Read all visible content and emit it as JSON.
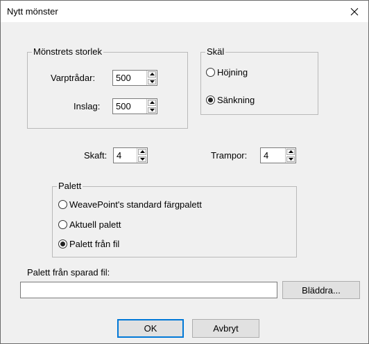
{
  "window": {
    "title": "Nytt mönster"
  },
  "size_group": {
    "label": "Mönstrets storlek",
    "warp_label": "Varptrådar:",
    "warp_value": "500",
    "weft_label": "Inslag:",
    "weft_value": "500"
  },
  "reason_group": {
    "label": "Skäl",
    "options": [
      "Höjning",
      "Sänkning"
    ],
    "selected": "Sänkning"
  },
  "shafts": {
    "label": "Skaft:",
    "value": "4"
  },
  "treadles": {
    "label": "Trampor:",
    "value": "4"
  },
  "palette_group": {
    "label": "Palett",
    "options": [
      "WeavePoint's standard färgpalett",
      "Aktuell palett",
      "Palett från fil"
    ],
    "selected": "Palett från fil"
  },
  "palette_file": {
    "label": "Palett från sparad fil:",
    "value": "",
    "browse_label": "Bläddra..."
  },
  "buttons": {
    "ok": "OK",
    "cancel": "Avbryt"
  },
  "icons": {
    "close": "close-icon",
    "spin_up": "arrow-up-icon",
    "spin_down": "arrow-down-icon"
  }
}
